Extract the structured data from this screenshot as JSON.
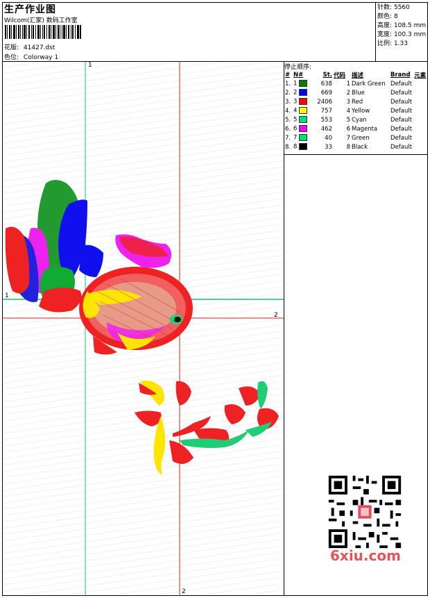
{
  "header": {
    "title": "生产作业图",
    "studio": "Wilcom(汇家) 数码工作室",
    "design_label": "花版:",
    "design_file": "41427.dst",
    "colorway_label": "色位:",
    "colorway": "Colorway 1"
  },
  "stats": [
    {
      "label": "针数",
      "sep": ":",
      "value": "5560"
    },
    {
      "label": "颜色",
      "sep": ":",
      "value": "8"
    },
    {
      "label": "高度",
      "sep": ":",
      "value": "108.5 mm"
    },
    {
      "label": "宽度",
      "sep": ":",
      "value": "100.3 mm"
    },
    {
      "label": "比例",
      "sep": ":",
      "value": "1.33"
    }
  ],
  "sequence": {
    "title": "停止顺序:",
    "headers": [
      "#",
      "N#",
      "St.",
      "代码",
      "描述",
      "Brand",
      "元素"
    ],
    "rows": [
      {
        "n": "1.",
        "seq": "1",
        "color": "#008000",
        "stitches": "638",
        "code": "1",
        "desc": "Dark Green",
        "brand": "Default"
      },
      {
        "n": "2.",
        "seq": "2",
        "color": "#0000ff",
        "stitches": "669",
        "code": "2",
        "desc": "Blue",
        "brand": "Default"
      },
      {
        "n": "3.",
        "seq": "3",
        "color": "#ff0000",
        "stitches": "2406",
        "code": "3",
        "desc": "Red",
        "brand": "Default"
      },
      {
        "n": "4.",
        "seq": "4",
        "color": "#ffff00",
        "stitches": "757",
        "code": "4",
        "desc": "Yellow",
        "brand": "Default"
      },
      {
        "n": "5.",
        "seq": "5",
        "color": "#00e080",
        "stitches": "553",
        "code": "5",
        "desc": "Cyan",
        "brand": "Default"
      },
      {
        "n": "6.",
        "seq": "6",
        "color": "#ff00ff",
        "stitches": "462",
        "code": "6",
        "desc": "Magenta",
        "brand": "Default"
      },
      {
        "n": "7.",
        "seq": "7",
        "color": "#00e070",
        "stitches": "40",
        "code": "7",
        "desc": "Green",
        "brand": "Default"
      },
      {
        "n": "8.",
        "seq": "8",
        "color": "#000000",
        "stitches": "33",
        "code": "8",
        "desc": "Black",
        "brand": "Default"
      }
    ]
  },
  "guides": {
    "green_v_label": "1",
    "green_h_label": "1",
    "red_h_label": "2",
    "red_v_label": "2",
    "green_color": "#00cc66",
    "red_color": "#dd2222"
  },
  "watermark": "6xiu.com"
}
